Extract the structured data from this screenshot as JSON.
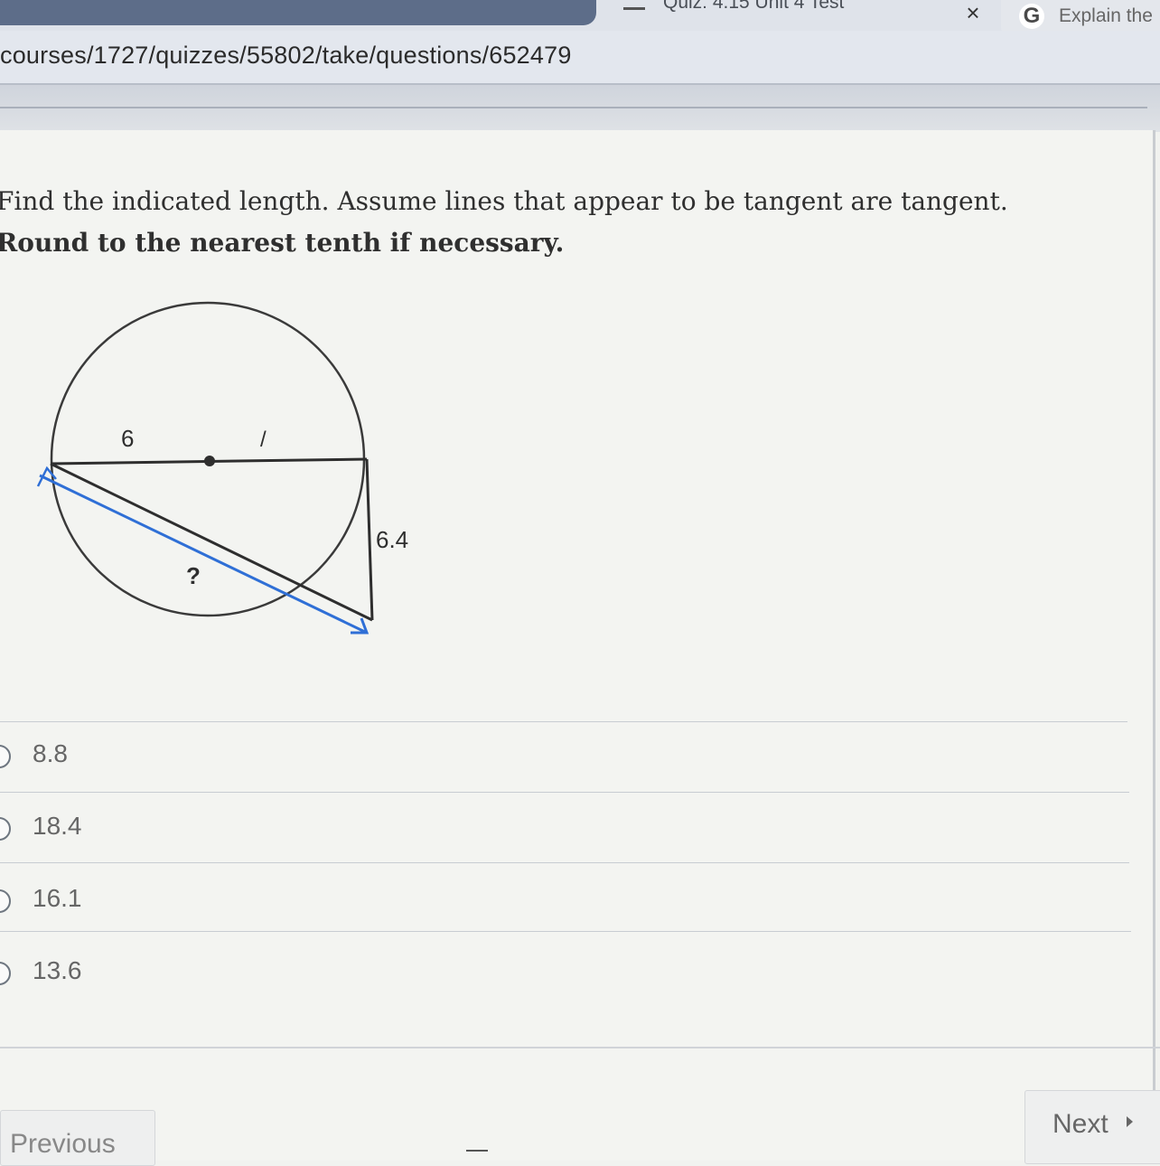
{
  "browser": {
    "tab_title": "Quiz: 4.15 Unit 4 Test",
    "tab_close": "×",
    "extension_tab_label": "Explain the",
    "extension_icon_letter": "G",
    "url": "courses/1727/quizzes/55802/take/questions/652479"
  },
  "question": {
    "text": "Find the indicated length. Assume lines that appear to be tangent are tangent. ",
    "bold_text": "Round to the nearest tenth if necessary."
  },
  "figure": {
    "label_left_segment": "6",
    "label_right_segment": "/",
    "label_tangent": "6.4",
    "label_unknown": "?",
    "annotation_color": "#2f6fd6"
  },
  "options": [
    {
      "label": "8.8"
    },
    {
      "label": "18.4"
    },
    {
      "label": "16.1"
    },
    {
      "label": "13.6"
    }
  ],
  "nav": {
    "previous": "Previous",
    "next": "Next"
  }
}
